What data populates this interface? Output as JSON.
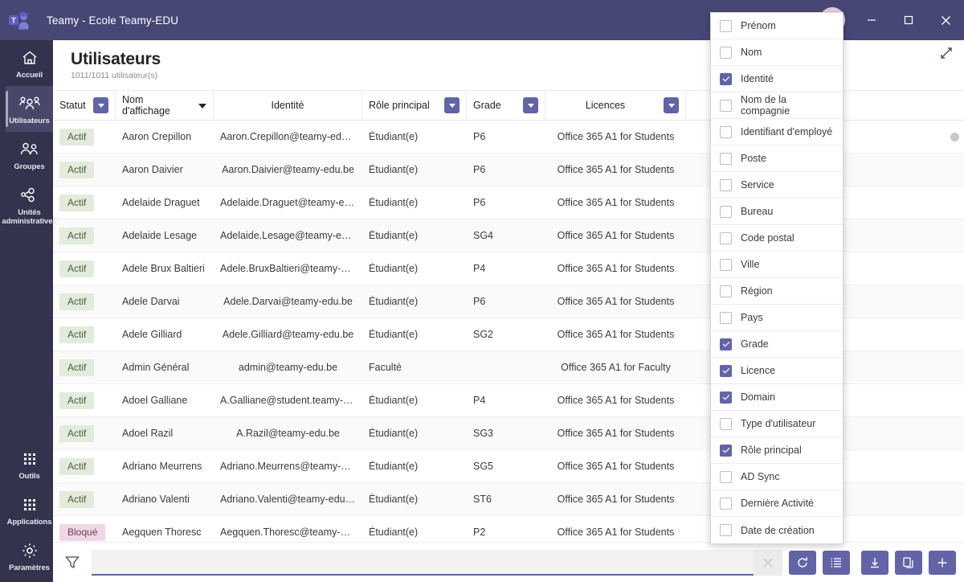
{
  "window": {
    "app_title": "Teamy - Ecole Teamy-EDU",
    "logo_icon": "teamy-graduate-logo",
    "avatar_icon": "user-avatar",
    "minimize_label": "Minimiser",
    "maximize_label": "Agrandir",
    "close_label": "Fermer",
    "accent_color": "#6264a7",
    "titlebar_color": "#464775",
    "rail_color": "#33334d"
  },
  "sidebar": {
    "items": [
      {
        "label": "Accueil",
        "icon": "home-icon",
        "active": false
      },
      {
        "label": "Utilisateurs",
        "icon": "users-icon",
        "active": true
      },
      {
        "label": "Groupes",
        "icon": "group-icon",
        "active": false
      },
      {
        "label": "Unités\nadministratives",
        "icon": "org-units-icon",
        "active": false
      }
    ],
    "bottom_items": [
      {
        "label": "Outils",
        "icon": "tools-grid-icon"
      },
      {
        "label": "Applications",
        "icon": "apps-grid-icon"
      },
      {
        "label": "Paramètres",
        "icon": "gear-icon"
      }
    ]
  },
  "page": {
    "title": "Utilisateurs",
    "subtitle": "1011/1011 utilisateur(s)",
    "expand_icon": "expand-diagonal-icon"
  },
  "table": {
    "columns": [
      {
        "key": "statut",
        "label": "Statut",
        "filter": true,
        "sorted": false,
        "align": "left"
      },
      {
        "key": "nom",
        "label": "Nom d'affichage",
        "filter": false,
        "sorted": true,
        "align": "left"
      },
      {
        "key": "identite",
        "label": "Identité",
        "filter": false,
        "sorted": false,
        "align": "center"
      },
      {
        "key": "role",
        "label": "Rôle principal",
        "filter": true,
        "sorted": false,
        "align": "left"
      },
      {
        "key": "grade",
        "label": "Grade",
        "filter": true,
        "sorted": false,
        "align": "left"
      },
      {
        "key": "licences",
        "label": "Licences",
        "filter": true,
        "sorted": false,
        "align": "center"
      },
      {
        "key": "domain",
        "label": "",
        "filter": false,
        "sorted": false,
        "align": "left"
      }
    ],
    "rows": [
      {
        "statut": "Actif",
        "nom": "Aaron Crepillon",
        "identite": "Aaron.Crepillon@teamy-edu.be",
        "role": "Étudiant(e)",
        "grade": "P6",
        "licences": "Office 365 A1 for Students"
      },
      {
        "statut": "Actif",
        "nom": "Aaron Daivier",
        "identite": "Aaron.Daivier@teamy-edu.be",
        "role": "Étudiant(e)",
        "grade": "P6",
        "licences": "Office 365 A1 for Students"
      },
      {
        "statut": "Actif",
        "nom": "Adelaide Draguet",
        "identite": "Adelaide.Draguet@teamy-edu.be",
        "role": "Étudiant(e)",
        "grade": "P6",
        "licences": "Office 365 A1 for Students"
      },
      {
        "statut": "Actif",
        "nom": "Adelaide Lesage",
        "identite": "Adelaide.Lesage@teamy-edu.be",
        "role": "Étudiant(e)",
        "grade": "SG4",
        "licences": "Office 365 A1 for Students"
      },
      {
        "statut": "Actif",
        "nom": "Adele Brux Baltieri",
        "identite": "Adele.BruxBaltieri@teamy-edu.be",
        "role": "Étudiant(e)",
        "grade": "P4",
        "licences": "Office 365 A1 for Students"
      },
      {
        "statut": "Actif",
        "nom": "Adele Darvai",
        "identite": "Adele.Darvai@teamy-edu.be",
        "role": "Étudiant(e)",
        "grade": "P6",
        "licences": "Office 365 A1 for Students"
      },
      {
        "statut": "Actif",
        "nom": "Adele Gilliard",
        "identite": "Adele.Gilliard@teamy-edu.be",
        "role": "Étudiant(e)",
        "grade": "SG2",
        "licences": "Office 365 A1 for Students"
      },
      {
        "statut": "Actif",
        "nom": "Admin Général",
        "identite": "admin@teamy-edu.be",
        "role": "Faculté",
        "grade": "",
        "licences": "Office 365 A1 for Faculty"
      },
      {
        "statut": "Actif",
        "nom": "Adoel Galliane",
        "identite": "A.Galliane@student.teamy-edu.be",
        "role": "Étudiant(e)",
        "grade": "P4",
        "licences": "Office 365 A1 for Students"
      },
      {
        "statut": "Actif",
        "nom": "Adoel Razil",
        "identite": "A.Razil@teamy-edu.be",
        "role": "Étudiant(e)",
        "grade": "SG3",
        "licences": "Office 365 A1 for Students"
      },
      {
        "statut": "Actif",
        "nom": "Adriano Meurrens",
        "identite": "Adriano.Meurrens@teamy-edu.be",
        "role": "Étudiant(e)",
        "grade": "SG5",
        "licences": "Office 365 A1 for Students"
      },
      {
        "statut": "Actif",
        "nom": "Adriano Valenti",
        "identite": "Adriano.Valenti@teamy-edu.be",
        "role": "Étudiant(e)",
        "grade": "ST6",
        "licences": "Office 365 A1 for Students"
      },
      {
        "statut": "Bloqué",
        "nom": "Aegquen Thoresc",
        "identite": "Aegquen.Thoresc@teamy-edu.be",
        "role": "Étudiant(e)",
        "grade": "P2",
        "licences": "Office 365 A1 for Students"
      }
    ]
  },
  "columns_menu": {
    "items": [
      {
        "label": "Prénom",
        "checked": false
      },
      {
        "label": "Nom",
        "checked": false
      },
      {
        "label": "Identité",
        "checked": true
      },
      {
        "label": "Nom de la compagnie",
        "checked": false
      },
      {
        "label": "Identifiant d'employé",
        "checked": false
      },
      {
        "label": "Poste",
        "checked": false
      },
      {
        "label": "Service",
        "checked": false
      },
      {
        "label": "Bureau",
        "checked": false
      },
      {
        "label": "Code postal",
        "checked": false
      },
      {
        "label": "Ville",
        "checked": false
      },
      {
        "label": "Région",
        "checked": false
      },
      {
        "label": "Pays",
        "checked": false
      },
      {
        "label": "Grade",
        "checked": true
      },
      {
        "label": "Licence",
        "checked": true
      },
      {
        "label": "Domain",
        "checked": true
      },
      {
        "label": "Type d'utilisateur",
        "checked": false
      },
      {
        "label": "Rôle principal",
        "checked": true
      },
      {
        "label": "AD Sync",
        "checked": false
      },
      {
        "label": "Dernière Activité",
        "checked": false
      },
      {
        "label": "Date de création",
        "checked": false
      }
    ]
  },
  "toolbar": {
    "filter_icon": "funnel-icon",
    "search_value": "",
    "search_placeholder": "",
    "clear_label": "×",
    "buttons": [
      {
        "name": "refresh-button",
        "icon": "refresh-icon"
      },
      {
        "name": "columns-button",
        "icon": "columns-list-icon"
      },
      {
        "name": "export-button",
        "icon": "download-icon"
      },
      {
        "name": "duplicate-button",
        "icon": "copy-icon"
      },
      {
        "name": "add-user-button",
        "icon": "plus-icon"
      }
    ]
  }
}
